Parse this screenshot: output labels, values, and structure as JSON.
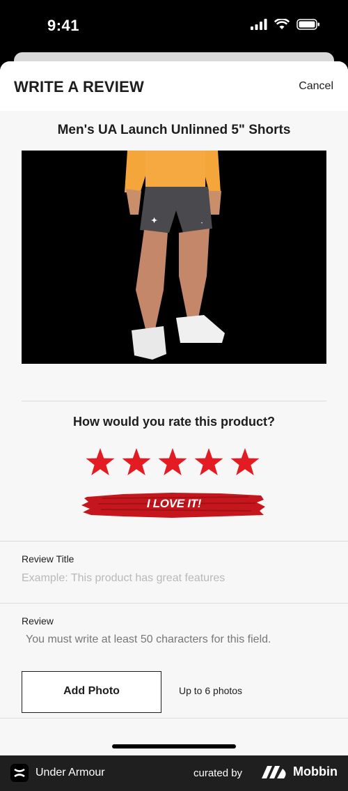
{
  "status_bar": {
    "time": "9:41"
  },
  "header": {
    "title": "WRITE A REVIEW",
    "cancel_label": "Cancel"
  },
  "product": {
    "name": "Men's UA Launch Unlinned 5\" Shorts"
  },
  "rating": {
    "question": "How would you rate this product?",
    "value": 5,
    "max": 5,
    "badge": "I LOVE IT!",
    "star_color": "#e31b23"
  },
  "review_title": {
    "label": "Review Title",
    "placeholder": "Example: This product has great features"
  },
  "review": {
    "label": "Review",
    "placeholder": "You must write at least 50 characters for this field."
  },
  "photos": {
    "button_label": "Add Photo",
    "limit_text": "Up to 6 photos"
  },
  "footer": {
    "brand": "Under Armour",
    "curated_by": "curated by",
    "curator": "Mobbin"
  }
}
